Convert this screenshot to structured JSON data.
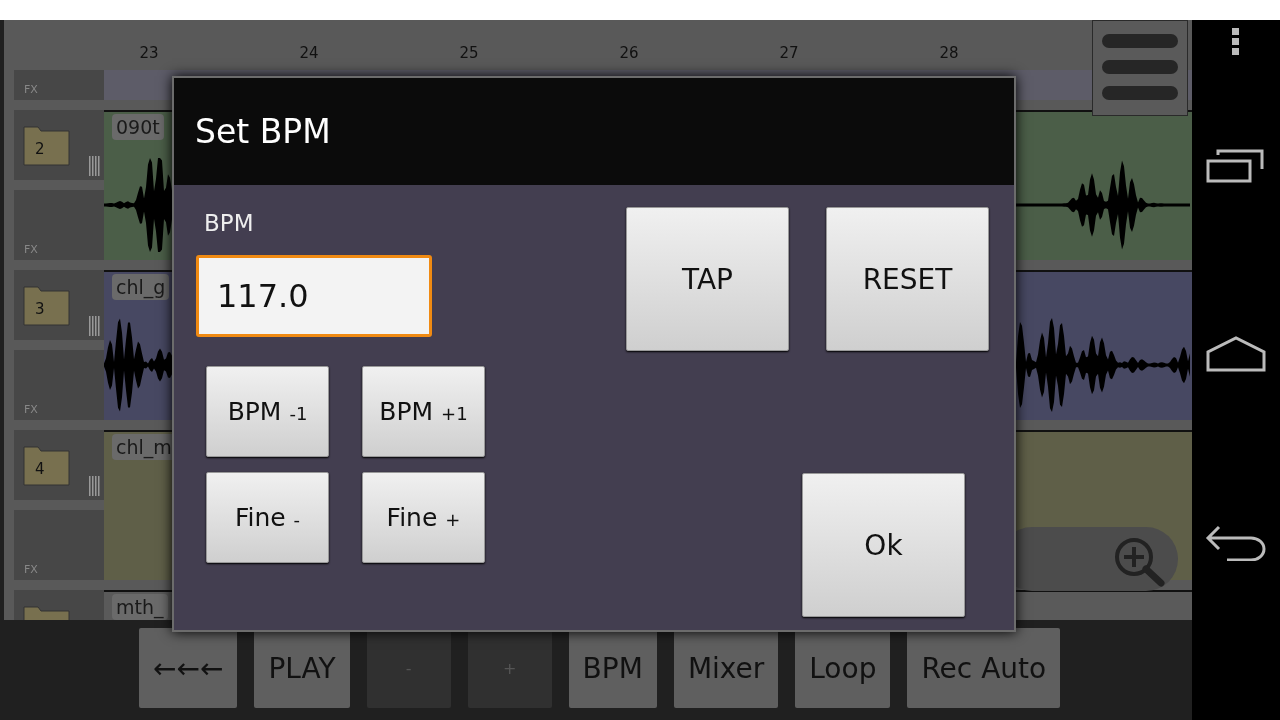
{
  "ruler": {
    "marks": [
      "23",
      "24",
      "25",
      "26",
      "27",
      "28"
    ]
  },
  "track_headers": [
    {
      "kind": "fx",
      "label": "FX"
    },
    {
      "kind": "folder",
      "number": "2"
    },
    {
      "kind": "fx",
      "label": "FX"
    },
    {
      "kind": "folder",
      "number": "3"
    },
    {
      "kind": "fx",
      "label": "FX"
    },
    {
      "kind": "folder",
      "number": "4"
    },
    {
      "kind": "fx",
      "label": "FX"
    },
    {
      "kind": "folder"
    }
  ],
  "lanes": [
    {
      "clip_label": "090t",
      "color": "#4b5e48",
      "waveform": true
    },
    {
      "clip_label": "chl_g",
      "color": "#474862",
      "waveform": true
    },
    {
      "clip_label": "chl_m",
      "color": "#5f5f48",
      "waveform": false
    },
    {
      "clip_label": "mth_",
      "color": "#5a5a5a",
      "waveform": false
    }
  ],
  "dialog": {
    "title": "Set BPM",
    "field_label": "BPM",
    "value": "117.0",
    "buttons": [
      {
        "kind": "step",
        "label": "BPM $_{-1}$"
      },
      {
        "kind": "step",
        "label": "BPM $_{+1}$"
      },
      {
        "kind": "step",
        "label": "Fine $_{-}$"
      },
      {
        "kind": "step",
        "label": "Fine $_{+}$"
      },
      {
        "kind": "big",
        "label": "TAP"
      },
      {
        "kind": "big",
        "label": "RESET"
      },
      {
        "kind": "ok",
        "label": "Ok"
      }
    ]
  },
  "toolbar": [
    {
      "label": "←←←",
      "disabled": false
    },
    {
      "label": "PLAY",
      "disabled": false
    },
    {
      "label": "-",
      "disabled": true
    },
    {
      "label": "+",
      "disabled": true
    },
    {
      "label": "BPM",
      "disabled": false
    },
    {
      "label": "Mixer",
      "disabled": false
    },
    {
      "label": "Loop",
      "disabled": false
    },
    {
      "label": "Rec Auto",
      "disabled": false
    }
  ]
}
